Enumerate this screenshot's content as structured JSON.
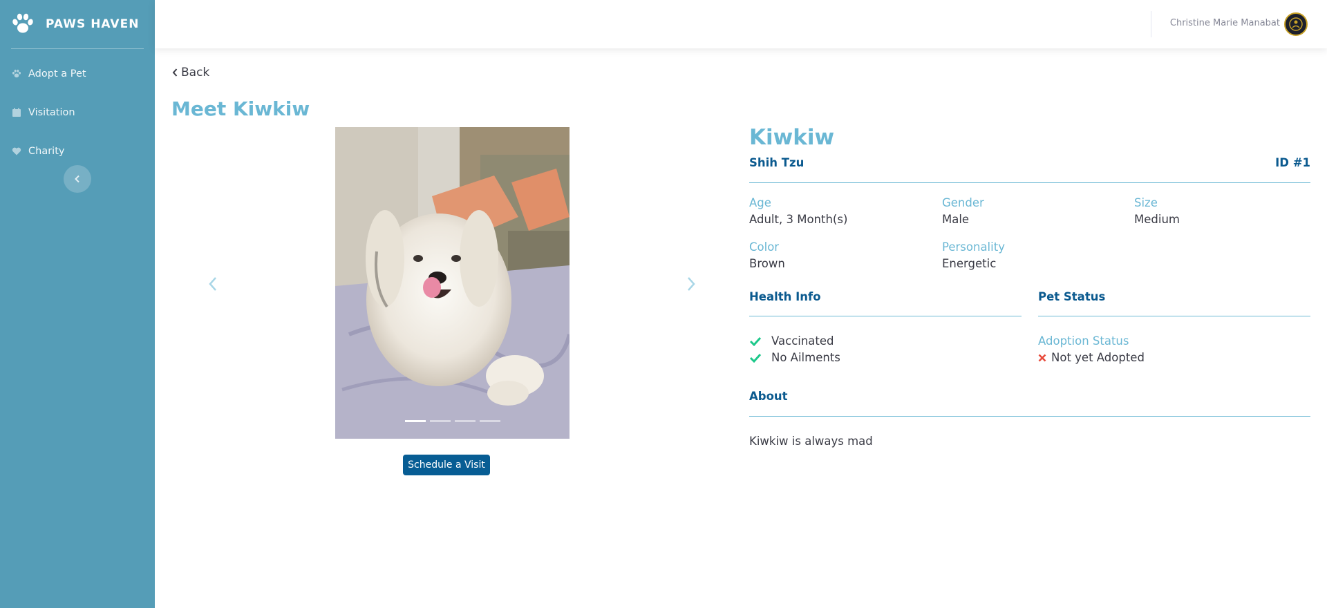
{
  "brand": {
    "name": "PAWS HAVEN",
    "icon": "paw-icon"
  },
  "sidebar": {
    "items": [
      {
        "label": "Adopt a Pet",
        "icon": "paw-icon"
      },
      {
        "label": "Visitation",
        "icon": "calendar-icon"
      },
      {
        "label": "Charity",
        "icon": "heart-icon"
      }
    ],
    "toggle_icon": "chevron-left-icon"
  },
  "topbar": {
    "user_name": "Christine Marie Manabat"
  },
  "page": {
    "back_label": "Back",
    "title": "Meet Kiwkiw"
  },
  "carousel": {
    "slide_count": 4,
    "active_index": 0,
    "schedule_label": "Schedule a Visit"
  },
  "pet": {
    "name": "Kiwkiw",
    "breed": "Shih Tzu",
    "id": "ID #1",
    "fields": {
      "age": {
        "label": "Age",
        "value": "Adult, 3 Month(s)"
      },
      "gender": {
        "label": "Gender",
        "value": "Male"
      },
      "size": {
        "label": "Size",
        "value": "Medium"
      },
      "color": {
        "label": "Color",
        "value": "Brown"
      },
      "personality": {
        "label": "Personality",
        "value": "Energetic"
      }
    },
    "health": {
      "heading": "Health Info",
      "items": [
        "Vaccinated",
        "No Ailments"
      ]
    },
    "status": {
      "heading": "Pet Status",
      "label": "Adoption Status",
      "value": "Not yet Adopted"
    },
    "about": {
      "heading": "About",
      "text": "Kiwkiw is always mad"
    }
  },
  "colors": {
    "sidebar": "#559db7",
    "accent": "#6ab7d4",
    "heading": "#0b5a8f",
    "button": "#075d94",
    "check": "#1cc88a",
    "cross": "#e74a3b"
  }
}
